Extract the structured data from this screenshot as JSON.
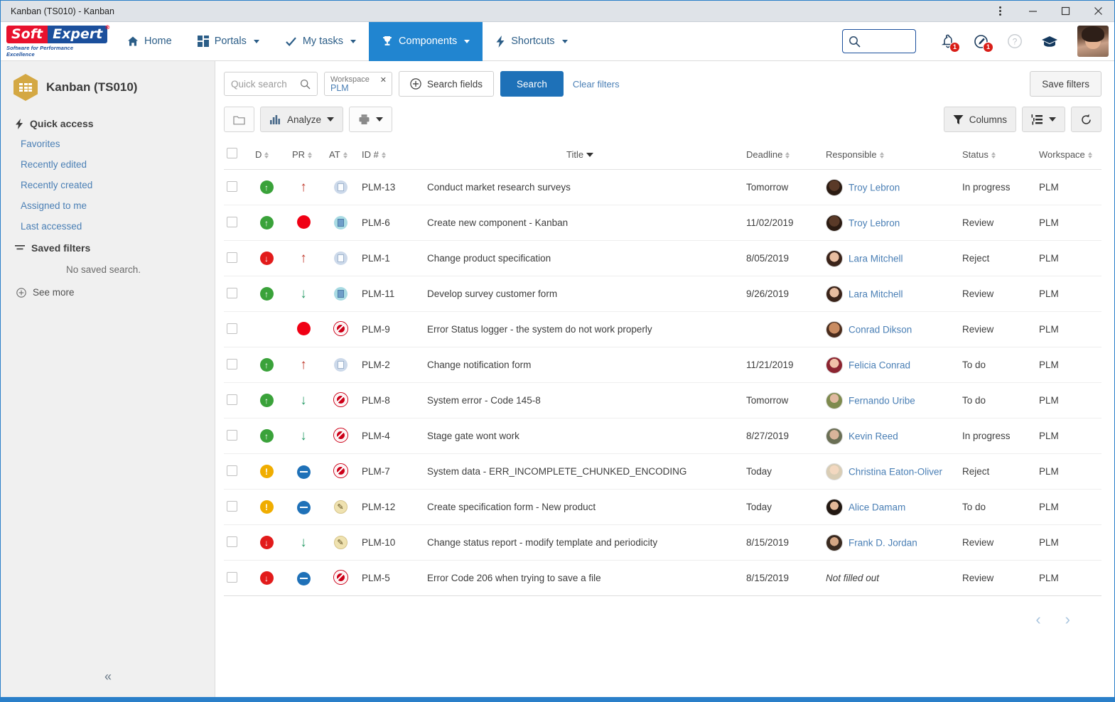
{
  "window": {
    "title": "Kanban (TS010) - Kanban",
    "controls": {
      "menu": "⋮",
      "minimize": "—",
      "maximize": "□",
      "close": "✕"
    }
  },
  "topnav": {
    "logo": {
      "part1": "Soft",
      "part2": "Expert",
      "registered": "®",
      "tagline": "Software for Performance Excellence"
    },
    "items": [
      {
        "label": "Home",
        "icon": "home-icon",
        "active": false,
        "has_caret": false
      },
      {
        "label": "Portals",
        "icon": "grid-icon",
        "active": false,
        "has_caret": true
      },
      {
        "label": "My tasks",
        "icon": "check-icon",
        "active": false,
        "has_caret": true
      },
      {
        "label": "Components",
        "icon": "trophy-icon",
        "active": true,
        "has_caret": true
      },
      {
        "label": "Shortcuts",
        "icon": "bolt-icon",
        "active": false,
        "has_caret": true
      }
    ],
    "search_value": "",
    "notifications_badge": "1",
    "alerts_badge": "1",
    "accent_blue": "#2185d0"
  },
  "sidebar": {
    "title": "Kanban (TS010)",
    "quick_access_label": "Quick access",
    "quick_access": [
      {
        "label": "Favorites"
      },
      {
        "label": "Recently edited"
      },
      {
        "label": "Recently created"
      },
      {
        "label": "Assigned to me"
      },
      {
        "label": "Last accessed"
      }
    ],
    "saved_filters_label": "Saved filters",
    "saved_filters_empty": "No saved search.",
    "see_more": "See more",
    "collapse": "«"
  },
  "filterbar": {
    "quick_search_placeholder": "Quick search",
    "chip": {
      "label": "Workspace",
      "value": "PLM",
      "close": "✕"
    },
    "search_fields": "Search fields",
    "search": "Search",
    "clear_filters": "Clear filters",
    "save_filters": "Save filters"
  },
  "toolbar": {
    "folder_icon": "folder-icon",
    "analyze": "Analyze",
    "print_icon": "printer-icon",
    "columns": "Columns",
    "view_icon": "list-view-icon",
    "refresh_icon": "refresh-icon"
  },
  "table": {
    "columns": [
      {
        "key": "d",
        "label": "D",
        "sorted": false
      },
      {
        "key": "pr",
        "label": "PR",
        "sorted": false
      },
      {
        "key": "at",
        "label": "AT",
        "sorted": false
      },
      {
        "key": "id",
        "label": "ID #",
        "sorted": false
      },
      {
        "key": "title",
        "label": "Title",
        "sorted": true
      },
      {
        "key": "deadline",
        "label": "Deadline",
        "sorted": false
      },
      {
        "key": "responsible",
        "label": "Responsible",
        "sorted": false
      },
      {
        "key": "status",
        "label": "Status",
        "sorted": false
      },
      {
        "key": "workspace",
        "label": "Workspace",
        "sorted": false
      }
    ],
    "rows": [
      {
        "d": "green-up",
        "pr": "arrow-up-red",
        "at": "doc-light",
        "id": "PLM-13",
        "title": "Conduct market research surveys",
        "deadline": "Tomorrow",
        "responsible": "Troy Lebron",
        "avatar": "dark-male",
        "status": "In progress",
        "workspace": "PLM"
      },
      {
        "d": "green-up",
        "pr": "dot-red",
        "at": "doc-blue",
        "id": "PLM-6",
        "title": "Create new component - Kanban",
        "deadline": "11/02/2019",
        "responsible": "Troy Lebron",
        "avatar": "dark-male",
        "status": "Review",
        "workspace": "PLM"
      },
      {
        "d": "red-down",
        "pr": "arrow-up-red",
        "at": "doc-light",
        "id": "PLM-1",
        "title": "Change product specification",
        "deadline": "8/05/2019",
        "responsible": "Lara Mitchell",
        "avatar": "brunette-female",
        "status": "Reject",
        "workspace": "PLM"
      },
      {
        "d": "green-up",
        "pr": "arrow-down-green",
        "at": "doc-blue",
        "id": "PLM-11",
        "title": "Develop survey customer form",
        "deadline": "9/26/2019",
        "responsible": "Lara Mitchell",
        "avatar": "brunette-female",
        "status": "Review",
        "workspace": "PLM"
      },
      {
        "d": "none",
        "pr": "dot-red",
        "at": "blocked",
        "id": "PLM-9",
        "title": "Error Status logger - the system do not work properly",
        "deadline": "",
        "responsible": "Conrad Dikson",
        "avatar": "tan-male",
        "status": "Review",
        "workspace": "PLM"
      },
      {
        "d": "green-up",
        "pr": "arrow-up-red",
        "at": "doc-light",
        "id": "PLM-2",
        "title": "Change notification form",
        "deadline": "11/21/2019",
        "responsible": "Felicia Conrad",
        "avatar": "red-female",
        "status": "To do",
        "workspace": "PLM"
      },
      {
        "d": "green-up",
        "pr": "arrow-down-green",
        "at": "blocked",
        "id": "PLM-8",
        "title": "System error - Code 145-8",
        "deadline": "Tomorrow",
        "responsible": "Fernando Uribe",
        "avatar": "beard-male",
        "status": "To do",
        "workspace": "PLM"
      },
      {
        "d": "green-up",
        "pr": "arrow-down-green",
        "at": "blocked",
        "id": "PLM-4",
        "title": "Stage gate wont work",
        "deadline": "8/27/2019",
        "responsible": "Kevin Reed",
        "avatar": "glasses-male",
        "status": "In progress",
        "workspace": "PLM"
      },
      {
        "d": "amber-excl",
        "pr": "minus-blue",
        "at": "blocked",
        "id": "PLM-7",
        "title": "System data - ERR_INCOMPLETE_CHUNKED_ENCODING",
        "deadline": "Today",
        "responsible": "Christina Eaton-Oliver",
        "avatar": "blonde-female",
        "status": "Reject",
        "workspace": "PLM"
      },
      {
        "d": "amber-excl",
        "pr": "minus-blue",
        "at": "note",
        "id": "PLM-12",
        "title": "Create specification form - New product",
        "deadline": "Today",
        "responsible": "Alice Damam",
        "avatar": "dark-female",
        "status": "To do",
        "workspace": "PLM"
      },
      {
        "d": "red-down",
        "pr": "arrow-down-green",
        "at": "note",
        "id": "PLM-10",
        "title": "Change status report - modify template and periodicity",
        "deadline": "8/15/2019",
        "responsible": "Frank D. Jordan",
        "avatar": "curly-male",
        "status": "Review",
        "workspace": "PLM"
      },
      {
        "d": "red-down",
        "pr": "minus-blue",
        "at": "blocked",
        "id": "PLM-5",
        "title": "Error Code 206 when trying to save a file",
        "deadline": "8/15/2019",
        "responsible": "Not filled out",
        "avatar": "none",
        "status": "Review",
        "workspace": "PLM"
      }
    ]
  },
  "pagination": {
    "prev": "‹",
    "next": "›"
  }
}
